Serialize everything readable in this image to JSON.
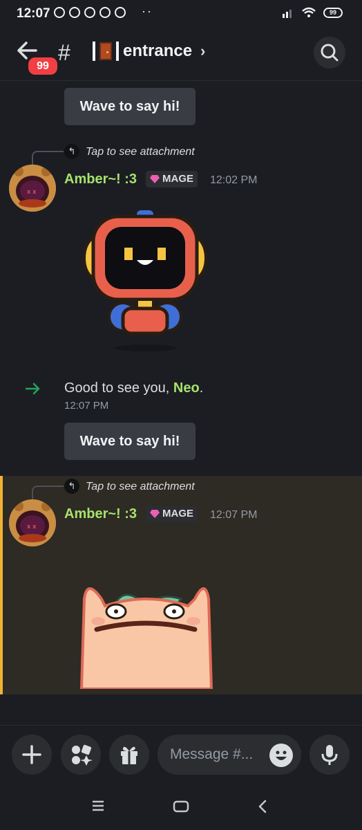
{
  "status_bar": {
    "time": "12:07",
    "dots": "··",
    "battery": "99"
  },
  "header": {
    "back_badge": "99",
    "hash": "#",
    "channel_name": "entrance",
    "chevron": "›"
  },
  "messages": {
    "wave_button_1": "Wave to say hi!",
    "msg1": {
      "reply_text": "Tap to see attachment",
      "author": "Amber~! :3",
      "role": "MAGE",
      "time": "12:02 PM"
    },
    "join": {
      "text_before": "Good to see you, ",
      "name": "Neo",
      "text_after": ".",
      "time": "12:07 PM"
    },
    "wave_button_2": "Wave to say hi!",
    "msg2": {
      "reply_text": "Tap to see attachment",
      "author": "Amber~! :3",
      "role": "MAGE",
      "time": "12:07 PM"
    }
  },
  "composer": {
    "placeholder": "Message #..."
  },
  "colors": {
    "background": "#1c1d22",
    "author_name": "#a6e36c",
    "highlight_bar": "#f0b232",
    "badge": "#f23f43"
  },
  "icons": [
    "back-arrow-icon",
    "search-icon",
    "reply-icon",
    "join-arrow-icon",
    "plus-icon",
    "apps-icon",
    "gift-icon",
    "emoji-icon",
    "microphone-icon",
    "nav-menu-icon",
    "nav-home-icon",
    "nav-back-icon"
  ]
}
